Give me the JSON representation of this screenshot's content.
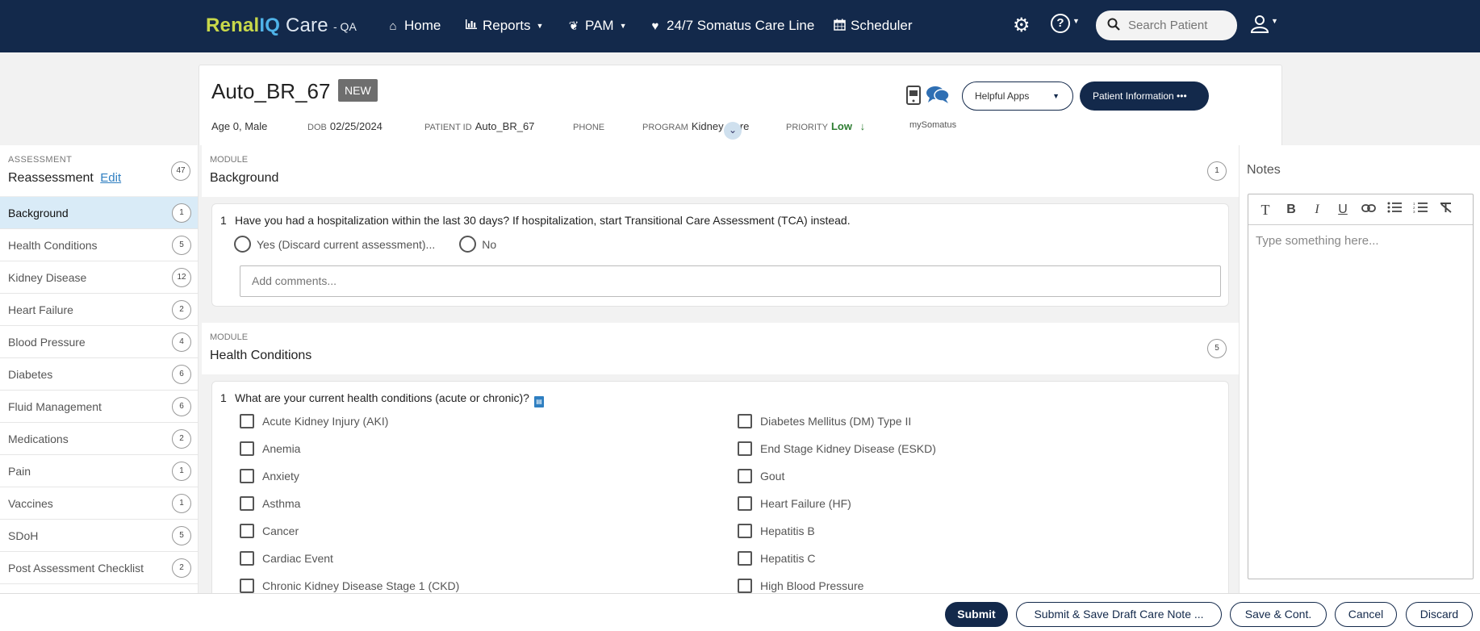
{
  "nav": {
    "brand_part1": "Renal",
    "brand_part2": "IQ",
    "brand_part3": " Care",
    "env": "- QA",
    "items": [
      {
        "label": "Home",
        "icon": "home-icon"
      },
      {
        "label": "Reports",
        "icon": "bar-chart-icon"
      },
      {
        "label": "PAM",
        "icon": "leaf-icon"
      },
      {
        "label": "24/7 Somatus Care Line",
        "icon": "heartbeat-icon"
      },
      {
        "label": "Scheduler",
        "icon": "calendar-icon"
      }
    ],
    "search_placeholder": "Search Patient"
  },
  "patient": {
    "name": "Auto_BR_67",
    "badge": "NEW",
    "age_sex": "Age 0, Male",
    "dob_label": "DOB",
    "dob": "02/25/2024",
    "pid_label": "PATIENT ID",
    "pid": "Auto_BR_67",
    "phone_label": "PHONE",
    "program_label": "PROGRAM",
    "program": "Kidney Care",
    "priority_label": "PRIORITY",
    "priority": "Low",
    "mysomatus": "mySomatus",
    "helpful_apps": "Helpful Apps",
    "patient_info": "Patient Information •••"
  },
  "sidebar": {
    "kicker": "ASSESSMENT",
    "title": "Reassessment",
    "edit": "Edit",
    "total": "47",
    "items": [
      {
        "label": "Background",
        "count": "1"
      },
      {
        "label": "Health Conditions",
        "count": "5"
      },
      {
        "label": "Kidney Disease",
        "count": "12"
      },
      {
        "label": "Heart Failure",
        "count": "2"
      },
      {
        "label": "Blood Pressure",
        "count": "4"
      },
      {
        "label": "Diabetes",
        "count": "6"
      },
      {
        "label": "Fluid Management",
        "count": "6"
      },
      {
        "label": "Medications",
        "count": "2"
      },
      {
        "label": "Pain",
        "count": "1"
      },
      {
        "label": "Vaccines",
        "count": "1"
      },
      {
        "label": "SDoH",
        "count": "5"
      },
      {
        "label": "Post Assessment Checklist",
        "count": "2"
      }
    ]
  },
  "modules": {
    "kicker": "MODULE",
    "background": {
      "title": "Background",
      "count": "1",
      "q_num": "1",
      "q_text": "Have you had a hospitalization within the last 30 days? If hospitalization, start Transitional Care Assessment (TCA) instead.",
      "opt_yes": "Yes (Discard current assessment)...",
      "opt_no": "No",
      "comments_placeholder": "Add comments..."
    },
    "health": {
      "title": "Health Conditions",
      "count": "5",
      "q_num": "1",
      "q_text": "What are your current health conditions (acute or chronic)?",
      "left": [
        "Acute Kidney Injury (AKI)",
        "Anemia",
        "Anxiety",
        "Asthma",
        "Cancer",
        "Cardiac Event",
        "Chronic Kidney Disease Stage 1 (CKD)"
      ],
      "right": [
        "Diabetes Mellitus (DM) Type II",
        "End Stage Kidney Disease (ESKD)",
        "Gout",
        "Heart Failure (HF)",
        "Hepatitis B",
        "Hepatitis C",
        "High Blood Pressure"
      ]
    }
  },
  "notes": {
    "title": "Notes",
    "placeholder": "Type something here..."
  },
  "footer": {
    "submit": "Submit",
    "submit_draft": "Submit & Save Draft Care Note ...",
    "save_cont": "Save & Cont.",
    "cancel": "Cancel",
    "discard": "Discard"
  }
}
